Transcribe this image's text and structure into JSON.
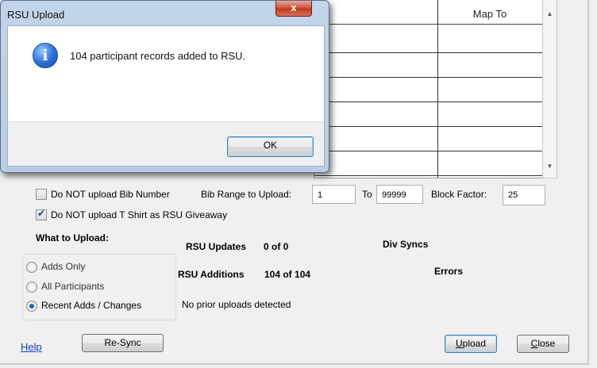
{
  "grid": {
    "map_to_header": "Map To"
  },
  "options": {
    "no_bib_label": "Do NOT upload Bib Number",
    "no_bib_checked": false,
    "no_tshirt_label": "Do NOT upload T Shirt as RSU Giveaway",
    "no_tshirt_checked": true,
    "bib_range_label": "Bib Range to Upload:",
    "bib_from": "1",
    "to_label": "To",
    "bib_to": "99999",
    "block_factor_label": "Block Factor:",
    "block_factor": "25"
  },
  "what_to_upload": {
    "heading": "What to Upload:",
    "choices": [
      "Adds Only",
      "All Participants",
      "Recent Adds / Changes"
    ],
    "selected": "Recent Adds / Changes"
  },
  "stats": {
    "rsu_updates_label": "RSU Updates",
    "rsu_updates_value": "0 of 0",
    "rsu_additions_label": "RSU Additions",
    "rsu_additions_value": "104 of 104",
    "div_syncs_label": "Div Syncs",
    "errors_label": "Errors",
    "prior_uploads_text": "No prior uploads detected"
  },
  "buttons": {
    "help": "Help",
    "resync": "Re-Sync",
    "upload": "Upload",
    "close": "Close"
  },
  "dialog": {
    "title": "RSU Upload",
    "close_glyph": "x",
    "icon": "info-icon",
    "message": "104 participant records added to RSU.",
    "ok": "OK"
  },
  "colors": {
    "link": "#0b40c4",
    "radio_selected": "#2a5fb7",
    "close_button": "#c23a22"
  }
}
